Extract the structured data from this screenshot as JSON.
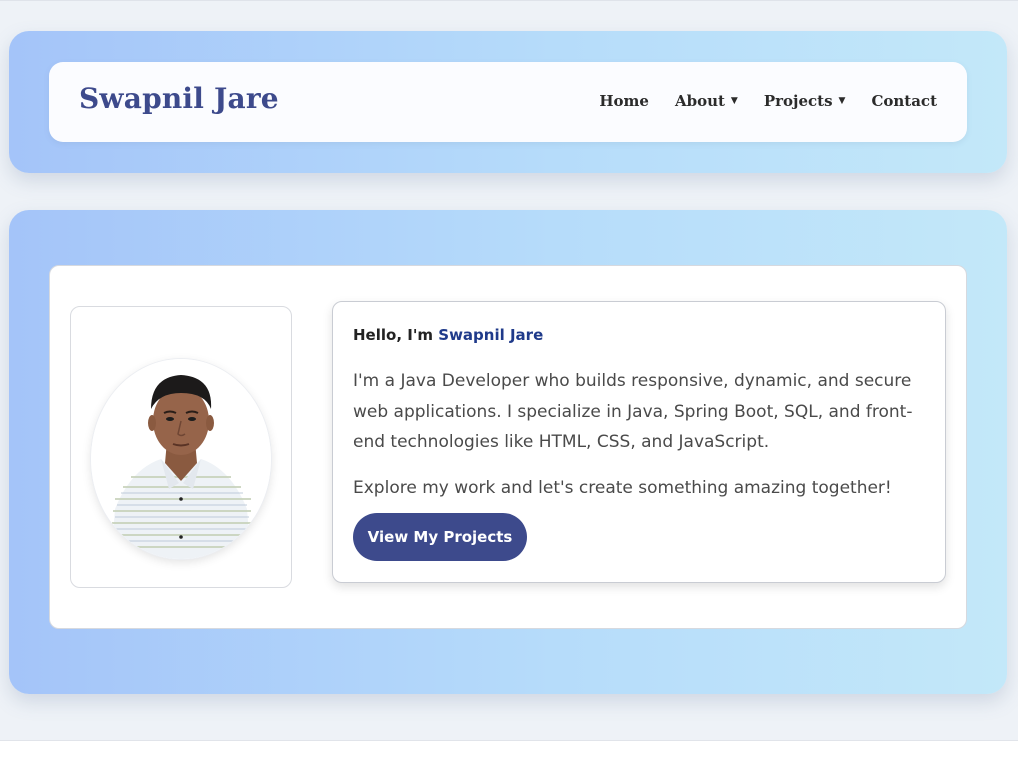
{
  "brand": {
    "name": "Swapnil Jare"
  },
  "nav": {
    "items": [
      {
        "label": "Home",
        "has_dropdown": false
      },
      {
        "label": "About",
        "has_dropdown": true
      },
      {
        "label": "Projects",
        "has_dropdown": true
      },
      {
        "label": "Contact",
        "has_dropdown": false
      }
    ],
    "caret_glyph": "▼"
  },
  "hero": {
    "greeting_prefix": "Hello, I'm ",
    "greeting_name": "Swapnil Jare",
    "paragraph1": "I'm a Java Developer who builds responsive, dynamic, and secure web applications. I specialize in Java, Spring Boot, SQL, and front-end technologies like HTML, CSS, and JavaScript.",
    "paragraph2": "Explore my work and let's create something amazing together!",
    "cta_label": "View My Projects",
    "profile_photo": "profile-photo"
  },
  "colors": {
    "brand": "#3d4a8c",
    "accent_name": "#1f3a8a",
    "band_gradient_start": "#a4c4f9",
    "band_gradient_end": "#c3e8f9",
    "page_background": "#eef2f7"
  }
}
